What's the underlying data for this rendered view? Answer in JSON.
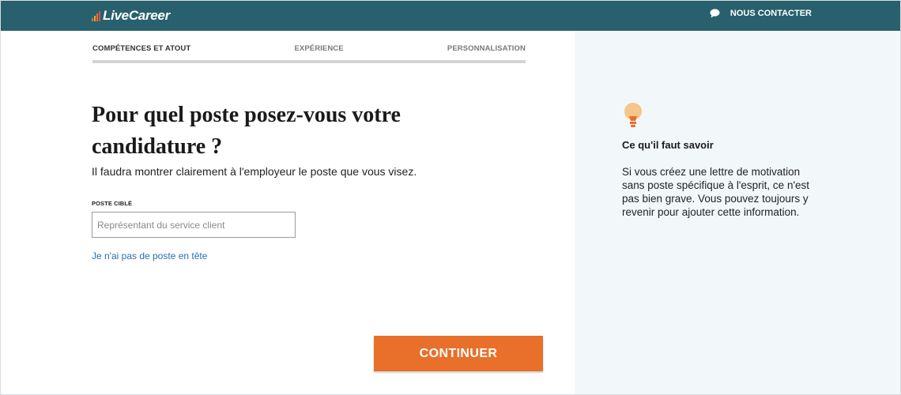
{
  "header": {
    "brand": "LiveCareer",
    "contact_label": "NOUS CONTACTER",
    "contact_icon": "chat-bubble-icon",
    "background": "#28606d"
  },
  "steps": {
    "items": [
      {
        "label": "COMPÉTENCES ET ATOUT",
        "active": true
      },
      {
        "label": "EXPÉRIENCE",
        "active": false
      },
      {
        "label": "PERSONNALISATION",
        "active": false
      }
    ],
    "progress_fraction": 0.0
  },
  "main": {
    "title": "Pour quel poste posez-vous votre candidature ?",
    "subtitle": "Il faudra montrer clairement à l'employeur le poste que vous visez.",
    "field_label": "POSTE CIBLÉ",
    "field_value": "",
    "field_placeholder": "Représentant du service client",
    "no_job_link": "Je n'ai pas de poste en tête",
    "continue_label": "CONTINUER",
    "accent": "#e8702a",
    "link_color": "#2a6db5"
  },
  "tip": {
    "icon": "lightbulb-icon",
    "title": "Ce qu'il faut savoir",
    "body": "Si vous créez une lettre de motivation sans poste spécifique à l'esprit, ce n'est pas bien grave. Vous pouvez toujours y revenir pour ajouter cette information.",
    "panel_background": "#f2f8fa"
  }
}
